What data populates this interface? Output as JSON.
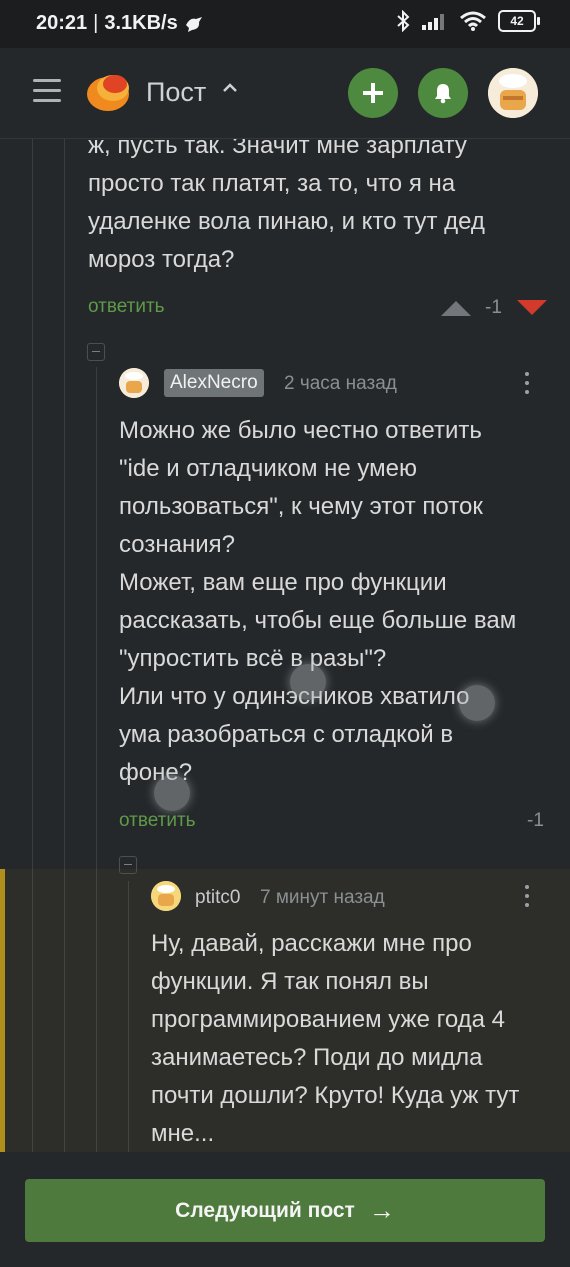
{
  "status_bar": {
    "time": "20:21",
    "separator": "|",
    "speed": "3.1KB/s",
    "battery": "42"
  },
  "header": {
    "title": "Пост"
  },
  "comments": [
    {
      "text": "ж, пусть так. Значит мне зарплату просто так платят, за то, что я на удаленке вола пинаю, и кто тут дед мороз тогда?",
      "lines": [
        "ж, пусть так. Значит мне зарплату",
        "просто так платят, за то, что я на",
        "удаленке вола пинаю, и кто тут дед",
        "мороз тогда?"
      ],
      "reply": "ответить",
      "rating": "-1"
    },
    {
      "author": "AlexNecro",
      "time": "2 часа назад",
      "lines": [
        "Можно же было честно ответить",
        "\"ide и отладчиком не умею",
        "пользоваться\", к чему этот поток",
        "сознания?",
        "Может, вам еще про функции",
        "рассказать, чтобы еще больше вам",
        "\"упростить всё в разы\"?",
        "Или что у одинэсников хватило",
        "ума разобраться с отладкой в",
        "фоне?"
      ],
      "reply": "ответить",
      "rating": "-1"
    },
    {
      "author": "ptitc0",
      "time": "7 минут назад",
      "lines": [
        "Ну, давай, расскажи мне про",
        "функции. Я так понял вы",
        "программированием уже года 4",
        "занимаетесь? Поди до мидла",
        "почти дошли? Круто! Куда уж тут",
        "мне..."
      ]
    }
  ],
  "next_post": {
    "label": "Следующий пост",
    "arrow": "→"
  },
  "colors": {
    "accent_green": "#4d8a3f",
    "downvote": "#d23b2b",
    "highlight_bar": "#b08f1c"
  }
}
